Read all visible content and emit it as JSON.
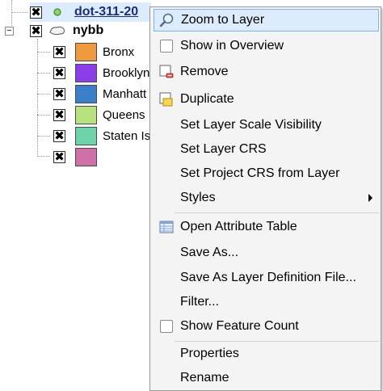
{
  "layers": {
    "top_layer": {
      "name": "dot-311-20",
      "checked": true
    },
    "group": {
      "name": "nybb",
      "collapse": "−",
      "checked": true
    },
    "classes": [
      {
        "label": "Bronx",
        "color": "#ef9a3f"
      },
      {
        "label": "Brooklyn",
        "color": "#8b3de8"
      },
      {
        "label": "Manhatt",
        "color": "#3b7fc9"
      },
      {
        "label": "Queens",
        "color": "#b7e27f"
      },
      {
        "label": "Staten Is",
        "color": "#6fd3a9"
      },
      {
        "label": "",
        "color": "#d070a8"
      }
    ]
  },
  "context_menu": {
    "items": [
      {
        "label": "Zoom to Layer",
        "icon": "zoom-icon",
        "highlighted": true
      },
      {
        "label": "Show in Overview",
        "icon": "checkbox"
      },
      {
        "label": "Remove",
        "icon": "remove-layer-icon"
      },
      {
        "label": "Duplicate",
        "icon": "duplicate-layer-icon"
      },
      {
        "label": "Set Layer Scale Visibility"
      },
      {
        "label": "Set Layer CRS"
      },
      {
        "label": "Set Project CRS from Layer"
      },
      {
        "label": "Styles",
        "submenu": true
      },
      {
        "label": "Open Attribute Table",
        "icon": "attribute-table-icon"
      },
      {
        "label": "Save As..."
      },
      {
        "label": "Save As Layer Definition File..."
      },
      {
        "label": "Filter..."
      },
      {
        "label": "Show Feature Count",
        "icon": "checkbox"
      },
      {
        "label": "Properties"
      },
      {
        "label": "Rename"
      }
    ]
  }
}
